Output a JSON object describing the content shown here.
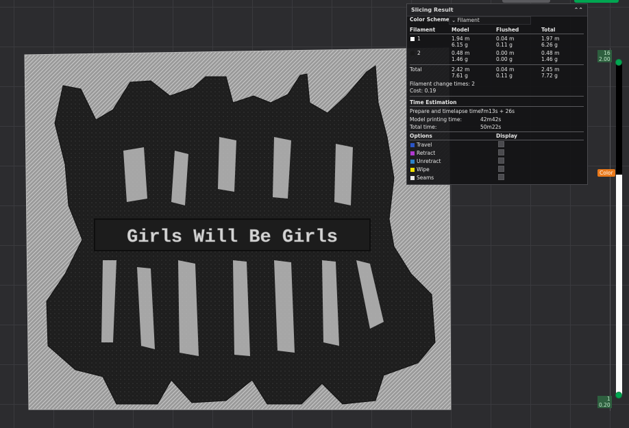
{
  "panel": {
    "title": "Slicing Result",
    "color_scheme_label": "Color Scheme",
    "color_scheme_value": "Filament",
    "columns": [
      "Filament",
      "Model",
      "Flushed",
      "Total"
    ],
    "filaments": [
      {
        "name": "1",
        "color": "#ffffff",
        "model_m": "1.94 m",
        "model_g": "6.15 g",
        "flushed_m": "0.04 m",
        "flushed_g": "0.11 g",
        "total_m": "1.97 m",
        "total_g": "6.26 g"
      },
      {
        "name": "2",
        "color": "#1a1a1a",
        "model_m": "0.48 m",
        "model_g": "1.46 g",
        "flushed_m": "0.00 m",
        "flushed_g": "0.00 g",
        "total_m": "0.48 m",
        "total_g": "1.46 g"
      }
    ],
    "total": {
      "label": "Total",
      "model_m": "2.42 m",
      "model_g": "7.61 g",
      "flushed_m": "0.04 m",
      "flushed_g": "0.11 g",
      "total_m": "2.45 m",
      "total_g": "7.72 g"
    },
    "filament_change": "Filament change times:  2",
    "cost": "Cost:  0.19",
    "time_title": "Time Estimation",
    "prepare_label": "Prepare and timelapse time:",
    "prepare_value": "7m13s + 26s",
    "model_label": "Model printing time:",
    "model_value": "42m42s",
    "total_label": "Total time:",
    "total_value": "50m22s",
    "options_header": "Options",
    "display_header": "Display",
    "options": [
      {
        "label": "Travel",
        "color": "#2a55c8"
      },
      {
        "label": "Retract",
        "color": "#b03ad0"
      },
      {
        "label": "Unretract",
        "color": "#2c82c9"
      },
      {
        "label": "Wipe",
        "color": "#f0e000"
      },
      {
        "label": "Seams",
        "color": "#e8e8e8"
      }
    ]
  },
  "slider": {
    "top_layer": "16",
    "top_height": "2.00",
    "bottom_layer": "1",
    "bottom_height": "0.20",
    "color_tag": "Color"
  },
  "plate": {
    "banner_text": "Girls Will Be Girls"
  }
}
